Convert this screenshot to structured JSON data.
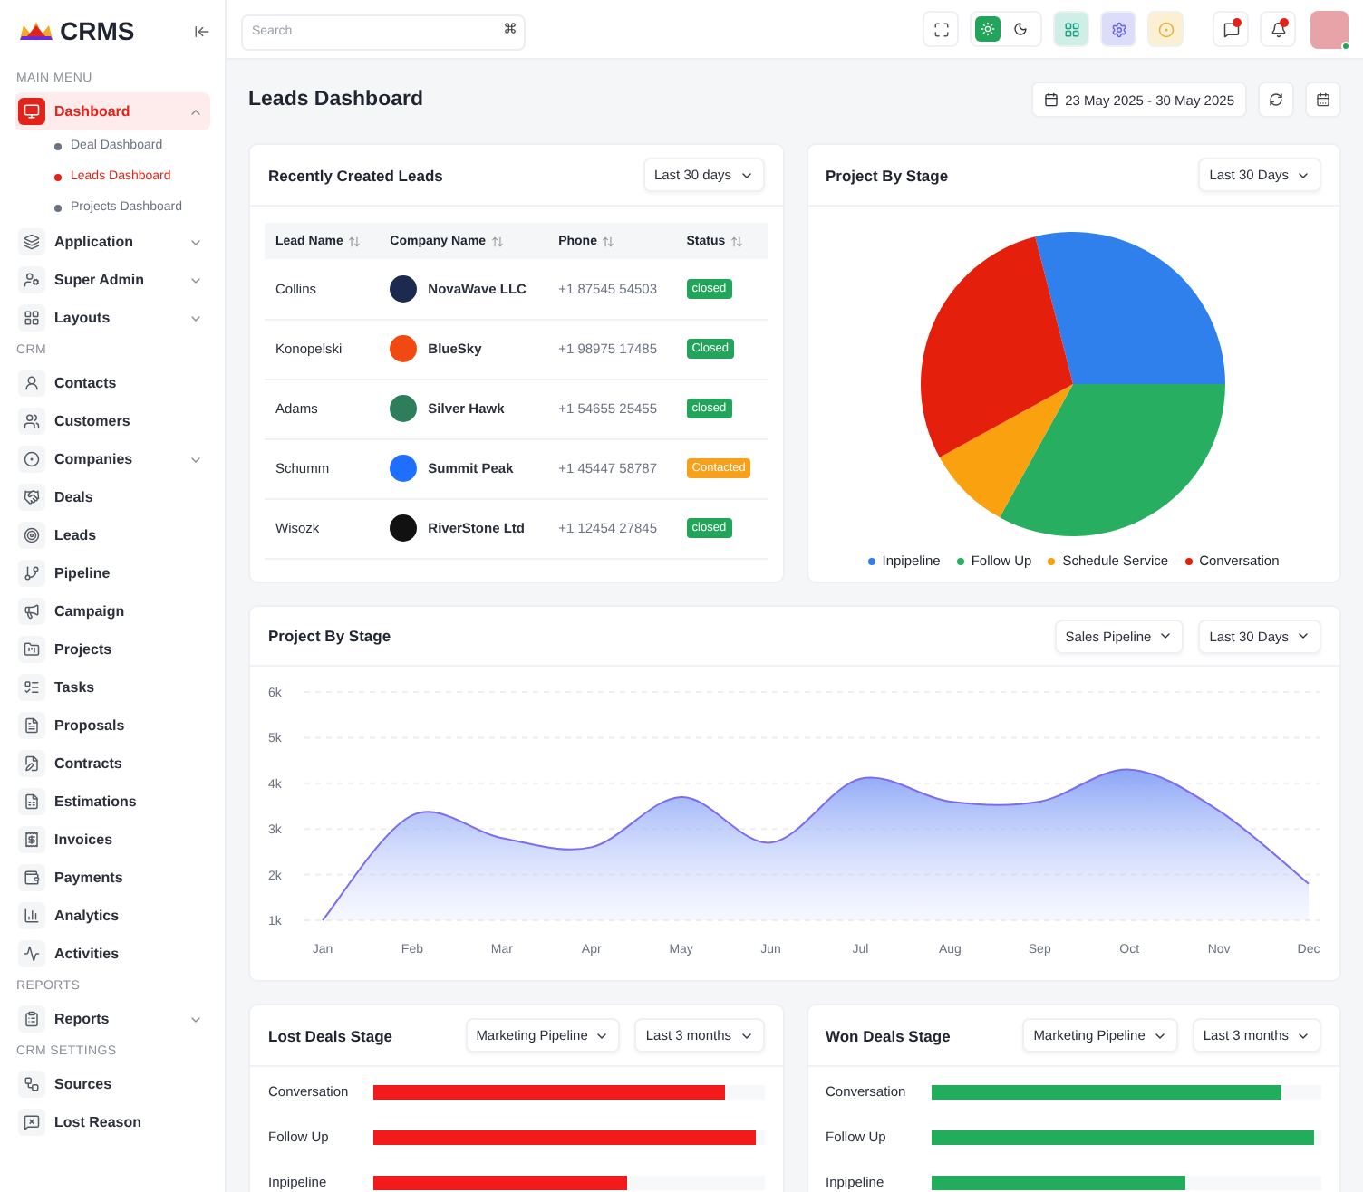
{
  "sidebar": {
    "logo": "CRMS",
    "sections": [
      {
        "title": "MAIN MENU",
        "items": [
          {
            "label": "Dashboard",
            "kind": "group",
            "expanded": true,
            "selected": true,
            "children": [
              {
                "label": "Deal Dashboard",
                "selected": false
              },
              {
                "label": "Leads Dashboard",
                "selected": true
              },
              {
                "label": "Projects Dashboard",
                "selected": false
              }
            ]
          },
          {
            "label": "Application",
            "kind": "group",
            "expanded": false,
            "selected": false
          },
          {
            "label": "Super Admin",
            "kind": "group",
            "expanded": false,
            "selected": false
          },
          {
            "label": "Layouts",
            "kind": "group",
            "expanded": false,
            "selected": false
          }
        ]
      },
      {
        "title": "CRM",
        "items": [
          {
            "label": "Contacts",
            "kind": "link",
            "selected": false
          },
          {
            "label": "Customers",
            "kind": "link",
            "selected": false
          },
          {
            "label": "Companies",
            "kind": "group",
            "expanded": false,
            "selected": false
          },
          {
            "label": "Deals",
            "kind": "link",
            "selected": false
          },
          {
            "label": "Leads",
            "kind": "link",
            "selected": false
          },
          {
            "label": "Pipeline",
            "kind": "link",
            "selected": false
          },
          {
            "label": "Campaign",
            "kind": "link",
            "selected": false
          },
          {
            "label": "Projects",
            "kind": "link",
            "selected": false
          },
          {
            "label": "Tasks",
            "kind": "link",
            "selected": false
          },
          {
            "label": "Proposals",
            "kind": "link",
            "selected": false
          },
          {
            "label": "Contracts",
            "kind": "link",
            "selected": false
          },
          {
            "label": "Estimations",
            "kind": "link",
            "selected": false
          },
          {
            "label": "Invoices",
            "kind": "link",
            "selected": false
          },
          {
            "label": "Payments",
            "kind": "link",
            "selected": false
          },
          {
            "label": "Analytics",
            "kind": "link",
            "selected": false
          },
          {
            "label": "Activities",
            "kind": "link",
            "selected": false
          }
        ]
      },
      {
        "title": "REPORTS",
        "items": [
          {
            "label": "Reports",
            "kind": "group",
            "expanded": false,
            "selected": false
          }
        ]
      },
      {
        "title": "CRM SETTINGS",
        "items": [
          {
            "label": "Sources",
            "kind": "link",
            "selected": false
          },
          {
            "label": "Lost Reason",
            "kind": "link",
            "selected": false
          }
        ]
      }
    ]
  },
  "topbar": {
    "search": {
      "placeholder": "Search"
    },
    "theme_modes": [
      {
        "kind": "light",
        "selected": true
      },
      {
        "kind": "dark",
        "selected": false
      }
    ]
  },
  "page": {
    "title": "Leads Dashboard",
    "date_range": "23 May 2025 - 30 May 2025"
  },
  "recent_leads": {
    "title": "Recently Created Leads",
    "filter": "Last 30 days",
    "columns": [
      "Lead Name",
      "Company Name",
      "Phone",
      "Status"
    ],
    "rows": [
      {
        "lead": "Collins",
        "company": "NovaWave LLC",
        "phone": "+1 87545 54503",
        "status": "closed",
        "color": "#22a55b"
      },
      {
        "lead": "Konopelski",
        "company": "BlueSky",
        "phone": "+1 98975 17485",
        "status": "Closed",
        "color": "#22a55b"
      },
      {
        "lead": "Adams",
        "company": "Silver Hawk",
        "phone": "+1 54655 25455",
        "status": "closed",
        "color": "#22a55b"
      },
      {
        "lead": "Schumm",
        "company": "Summit  Peak",
        "phone": "+1 45447 58787",
        "status": "Contacted",
        "color": "#f9a01b"
      },
      {
        "lead": "Wisozk",
        "company": "RiverStone Ltd",
        "phone": "+1 12454 27845",
        "status": "closed",
        "color": "#22a55b"
      }
    ]
  },
  "project_stage_pie": {
    "title": "Project By Stage",
    "filter": "Last 30 Days",
    "legend": [
      {
        "label": "Inpipeline",
        "color": "#2f80ed"
      },
      {
        "label": "Follow Up",
        "color": "#27ae60"
      },
      {
        "label": "Schedule Service",
        "color": "#f9a10e"
      },
      {
        "label": "Conversation",
        "color": "#e41f0b"
      }
    ]
  },
  "project_stage_line": {
    "title": "Project By Stage",
    "filters": [
      "Sales Pipeline",
      "Last 30 Days"
    ],
    "chart_data": {
      "type": "area",
      "categories": [
        "Jan",
        "Feb",
        "Mar",
        "Apr",
        "May",
        "Jun",
        "Jul",
        "Aug",
        "Sep",
        "Oct",
        "Nov",
        "Dec"
      ],
      "series": [
        {
          "color": "#7b6cf0",
          "values": [
            1.0,
            3.3,
            2.8,
            2.6,
            3.7,
            2.7,
            4.1,
            3.6,
            3.6,
            4.3,
            3.4,
            1.8
          ]
        }
      ],
      "ylim": [
        1,
        6
      ],
      "grid": true,
      "yticks": [
        {
          "value": 1,
          "label": "1k"
        },
        {
          "value": 2,
          "label": "2k"
        },
        {
          "value": 3,
          "label": "3k"
        },
        {
          "value": 4,
          "label": "4k"
        },
        {
          "value": 5,
          "label": "5k"
        },
        {
          "value": 6,
          "label": "6k"
        }
      ]
    }
  },
  "deal_stages": [
    {
      "title": "Lost Deals Stage",
      "filters": [
        "Marketing Pipeline",
        "Last 3 months"
      ],
      "color": "#f21a1a",
      "rows": [
        {
          "label": "Conversation",
          "level": 0.9
        },
        {
          "label": "Follow Up",
          "level": 0.98
        },
        {
          "label": "Inpipeline",
          "level": 0.65
        }
      ]
    },
    {
      "title": "Won Deals Stage",
      "filters": [
        "Marketing Pipeline",
        "Last 3 months"
      ],
      "color": "#22ad5c",
      "rows": [
        {
          "label": "Conversation",
          "level": 0.9
        },
        {
          "label": "Follow Up",
          "level": 0.98
        },
        {
          "label": "Inpipeline",
          "level": 0.65
        }
      ]
    }
  ]
}
